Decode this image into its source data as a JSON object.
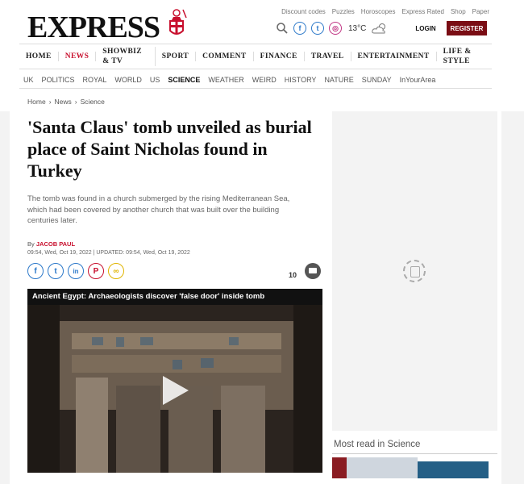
{
  "brand": {
    "logo": "EXPRESS",
    "crest_icon": "st-george-knight-crest-icon",
    "accent": "#c8102e",
    "register_bg": "#7a0d14"
  },
  "utility_links": [
    "Discount codes",
    "Puzzles",
    "Horoscopes",
    "Express Rated",
    "Shop",
    "Paper"
  ],
  "utility_bar": {
    "weather": "13°C",
    "login": "LOGIN",
    "register": "REGISTER"
  },
  "primary_nav": [
    "HOME",
    "NEWS",
    "SHOWBIZ & TV",
    "SPORT",
    "COMMENT",
    "FINANCE",
    "TRAVEL",
    "ENTERTAINMENT",
    "LIFE & STYLE"
  ],
  "primary_nav_active": "NEWS",
  "secondary_nav": [
    "UK",
    "POLITICS",
    "ROYAL",
    "WORLD",
    "US",
    "SCIENCE",
    "WEATHER",
    "WEIRD",
    "HISTORY",
    "NATURE",
    "SUNDAY",
    "InYourArea"
  ],
  "secondary_nav_active": "SCIENCE",
  "breadcrumb": [
    "Home",
    "News",
    "Science"
  ],
  "article": {
    "headline": "'Santa Claus' tomb unveiled as burial place of Saint Nicholas found in Turkey",
    "standfirst": "The tomb was found in a church submerged by the rising Mediterranean Sea, which had been covered by another church that was built over the building centuries later.",
    "by_prefix": "By",
    "author": "JACOB PAUL",
    "dates": "09:54, Wed, Oct 19, 2022 | UPDATED: 09:54, Wed, Oct 19, 2022",
    "comment_count": "10"
  },
  "video": {
    "title": "Ancient Egypt: Archaeologists discover 'false door' inside tomb"
  },
  "sidebar": {
    "most_read": "Most read in Science"
  }
}
